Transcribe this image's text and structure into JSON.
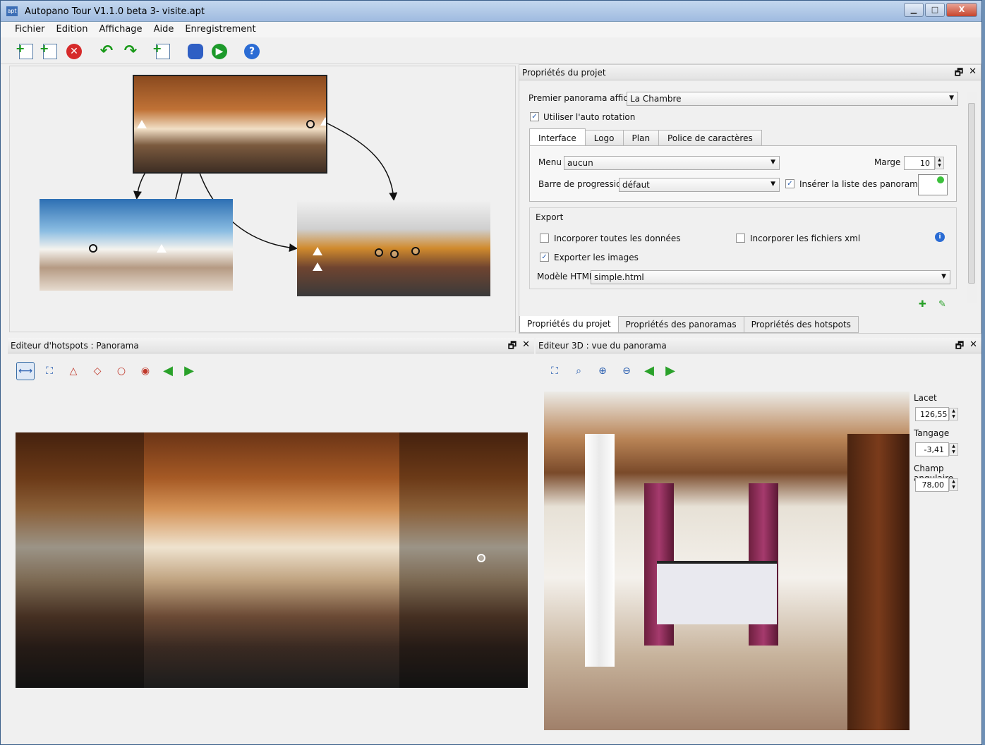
{
  "window": {
    "title": "Autopano Tour V1.1.0 beta 3- visite.apt",
    "app_icon": "apt",
    "buttons": {
      "minimize": "▁",
      "maximize": "□",
      "close": "X"
    }
  },
  "menu": {
    "items": [
      "Fichier",
      "Edition",
      "Affichage",
      "Aide",
      "Enregistrement"
    ]
  },
  "toolbar": {
    "icons": [
      "new-panorama-icon",
      "add-panorama-icon",
      "delete-icon",
      "undo-icon",
      "redo-icon",
      "import-icon",
      "settings-icon",
      "play-icon",
      "help-icon"
    ],
    "delete_glyph": "✕",
    "undo_glyph": "↶",
    "redo_glyph": "↷",
    "play_glyph": "▶",
    "help_glyph": "?"
  },
  "project_props": {
    "dock_title": "Propriétés du projet",
    "dock_buttons": [
      "🗗",
      "✕"
    ],
    "first_pano_label": "Premier panorama affiché",
    "first_pano_value": "La Chambre",
    "autorotate_label": "Utiliser l'auto rotation",
    "autorotate_checked": true,
    "tabs": [
      "Interface",
      "Logo",
      "Plan",
      "Police de caractères"
    ],
    "menu_label": "Menu",
    "menu_value": "aucun",
    "margin_label": "Marge",
    "margin_value": "10",
    "progress_label": "Barre de progression",
    "progress_value": "défaut",
    "insert_list_label": "Insérer la liste des panoramas",
    "insert_list_checked": true,
    "export_label": "Export",
    "embed_data_label": "Incorporer toutes les données",
    "embed_data_checked": false,
    "embed_xml_label": "Incorporer les fichiers xml",
    "embed_xml_checked": false,
    "export_images_label": "Exporter les images",
    "export_images_checked": true,
    "html_template_label": "Modèle HTML",
    "html_template_value": "simple.html",
    "bottom_tabs": [
      "Propriétés du projet",
      "Propriétés des panoramas",
      "Propriétés des hotspots"
    ]
  },
  "hotspot_editor": {
    "title": "Editeur d'hotspots : Panorama",
    "dock_buttons": [
      "🗗",
      "✕"
    ],
    "tools": [
      "pan-tool-icon",
      "fit-icon",
      "polygon-hotspot-icon",
      "polygon-edit-icon",
      "circle-hotspot-icon",
      "point-hotspot-icon",
      "previous-icon",
      "next-icon"
    ]
  },
  "editor_3d": {
    "title": "Editeur 3D : vue du panorama",
    "dock_buttons": [
      "🗗",
      "✕"
    ],
    "tools": [
      "fit-icon",
      "zoom-icon",
      "zoom-in-icon",
      "zoom-out-icon",
      "previous-icon",
      "next-icon"
    ],
    "yaw_label": "Lacet",
    "yaw_value": "126,55",
    "pitch_label": "Tangage",
    "pitch_value": "-3,41",
    "fov_label": "Champ angulaire",
    "fov_value": "78,00"
  },
  "colors": {
    "accent": "#3a6ea5",
    "green": "#2aa12a",
    "red": "#c0392b"
  }
}
